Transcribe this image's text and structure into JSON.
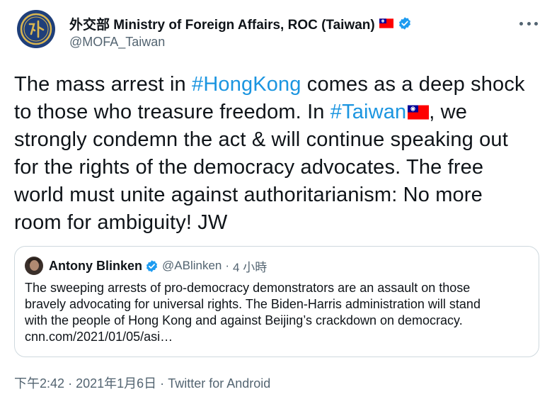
{
  "author": {
    "display_name": "外交部 Ministry of Foreign Affairs, ROC (Taiwan)",
    "handle": "@MOFA_Taiwan",
    "avatar_icon": "mofa-seal-icon",
    "verified": true,
    "name_emoji": "taiwan-flag-icon"
  },
  "tweet": {
    "lines": [
      [
        {
          "text": "The mass arrest in ",
          "type": "text"
        },
        {
          "text": "#HongKong",
          "type": "hashtag"
        },
        {
          "text": " comes as a deep shock",
          "type": "text"
        }
      ],
      [
        {
          "text": "to those who treasure freedom. In ",
          "type": "text"
        },
        {
          "text": "#Taiwan",
          "type": "hashtag"
        },
        {
          "text": "",
          "type": "flag"
        },
        {
          "text": ", we",
          "type": "text"
        }
      ],
      [
        {
          "text": "strongly condemn the act & will continue speaking out",
          "type": "text"
        }
      ],
      [
        {
          "text": "for the rights of the democracy advocates. The free",
          "type": "text"
        }
      ],
      [
        {
          "text": "world must unite against authoritarianism: No more",
          "type": "text"
        }
      ],
      [
        {
          "text": "room for ambiguity! JW",
          "type": "text"
        }
      ]
    ]
  },
  "quoted_tweet": {
    "display_name": "Antony Blinken",
    "handle": "@ABlinken",
    "separator": "·",
    "time": "4 小時",
    "verified": true,
    "body_lines": [
      "The sweeping arrests of pro-democracy demonstrators are an assault on those",
      "bravely advocating for universal rights. The Biden-Harris administration will stand",
      "with the people of Hong Kong and against Beijing’s crackdown on democracy.",
      "cnn.com/2021/01/05/asi…"
    ]
  },
  "footer": {
    "time": "下午2:42",
    "separator1": "·",
    "date": "2021年1月6日",
    "separator2": "·",
    "source": "Twitter for Android"
  },
  "colors": {
    "hashtag": "#1b95e0",
    "verified": "#1d9bf0",
    "secondary_text": "#536471",
    "border": "#cfd9de"
  }
}
